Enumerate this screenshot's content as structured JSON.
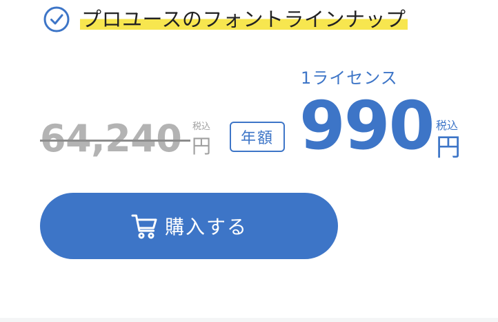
{
  "feature": {
    "text": "プロユースのフォントラインナップ"
  },
  "pricing": {
    "old_price": "64,240",
    "old_tax_label": "税込",
    "old_currency": "円",
    "badge_label": "年額",
    "license_label": "1ライセンス",
    "price": "990",
    "tax_label": "税込",
    "currency": "円"
  },
  "buy_button": {
    "label": "購入する"
  },
  "colors": {
    "accent": "#3d75c7",
    "highlight": "#f7e64f",
    "muted": "#b3b3b3"
  },
  "icons": {
    "feature_check": "check-circle-icon",
    "buy": "cart-icon"
  }
}
